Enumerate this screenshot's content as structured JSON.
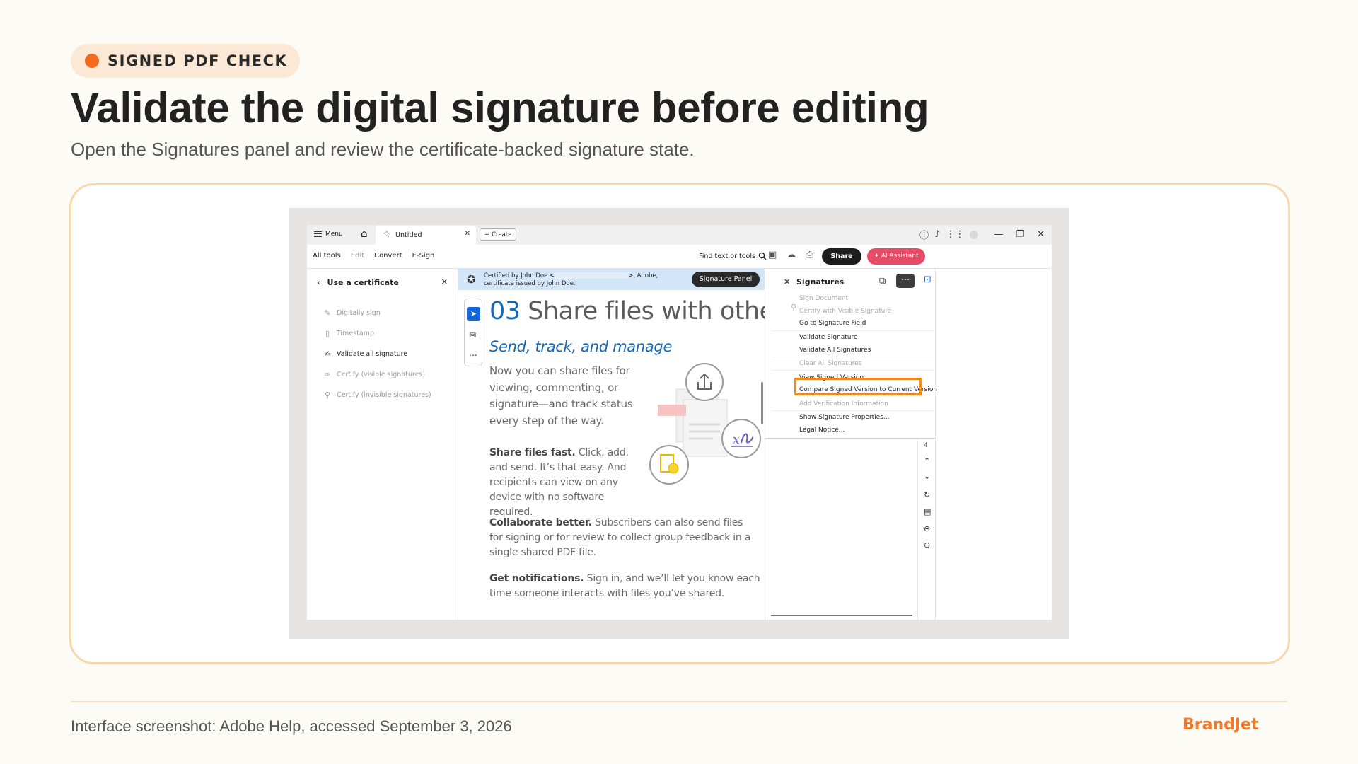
{
  "badge": {
    "label": "SIGNED PDF CHECK",
    "dot_color": "#f26b1d"
  },
  "heading": {
    "title": "Validate the digital signature before editing",
    "subtitle": "Open the Signatures panel and review the certificate-backed signature state."
  },
  "app": {
    "tabbar": {
      "menu_label": "Menu",
      "doc_tab": "Untitled",
      "create_label": "Create"
    },
    "toolbar": {
      "items": [
        "All tools",
        "Edit",
        "Convert",
        "E-Sign"
      ],
      "find_label": "Find text or tools",
      "share_label": "Share",
      "ai_label": "AI Assistant"
    },
    "left_panel": {
      "title": "Use a certificate",
      "items": [
        {
          "label": "Digitally sign",
          "icon": "pen-icon",
          "active": false
        },
        {
          "label": "Timestamp",
          "icon": "clock-doc-icon",
          "active": false
        },
        {
          "label": "Validate all signature",
          "icon": "validate-icon",
          "active": true
        },
        {
          "label": "Certify (visible signatures)",
          "icon": "certify-visible-icon",
          "active": false
        },
        {
          "label": "Certify (invisible signatures)",
          "icon": "ribbon-icon",
          "active": false
        }
      ]
    },
    "banner": {
      "text_before": "Certified by John Doe <",
      "text_after": ">, Adobe, certificate issued by John Doe.",
      "button": "Signature Panel"
    },
    "document": {
      "heading_num": "03",
      "heading_text": "Share files with others",
      "subheading": "Send, track, and manage",
      "intro": "Now you can share files for viewing, commenting, or signature—and track status every step of the way.",
      "sections": [
        {
          "bold": "Share files fast.",
          "text": " Click, add, and send. It’s that easy. And recipients can view on any device with no software required."
        },
        {
          "bold": "Collaborate better.",
          "text": " Subscribers can also send files for signing or for review to collect group feedback in a single shared PDF file."
        },
        {
          "bold": "Get notifications.",
          "text": " Sign in, and we’ll let you know each time someone interacts with files you’ve shared."
        }
      ]
    },
    "signatures_panel": {
      "title": "Signatures",
      "more_label": "⋯",
      "page_number": "4",
      "menu": [
        {
          "label": "Sign Document",
          "disabled": true
        },
        {
          "label": "Certify with Visible Signature",
          "disabled": true
        },
        {
          "label": "Go to Signature Field",
          "disabled": false
        },
        {
          "label": "Validate Signature",
          "disabled": false
        },
        {
          "label": "Validate All Signatures",
          "disabled": false
        },
        {
          "label": "Clear All Signatures",
          "disabled": true
        },
        {
          "label": "View Signed Version",
          "disabled": false
        },
        {
          "label": "Compare Signed Version to Current Version",
          "disabled": false,
          "highlighted": true
        },
        {
          "label": "Add Verification Information",
          "disabled": true
        },
        {
          "label": "Show Signature Properties...",
          "disabled": false
        },
        {
          "label": "Legal Notice...",
          "disabled": false
        }
      ]
    }
  },
  "footer": {
    "caption": "Interface screenshot: Adobe Help, accessed September 3, 2026",
    "brand": "BrandJet"
  },
  "colors": {
    "accent": "#f26b1d",
    "highlight_box": "#f08a1b",
    "brand": "#f07a28",
    "doc_blue": "#1766b0"
  }
}
